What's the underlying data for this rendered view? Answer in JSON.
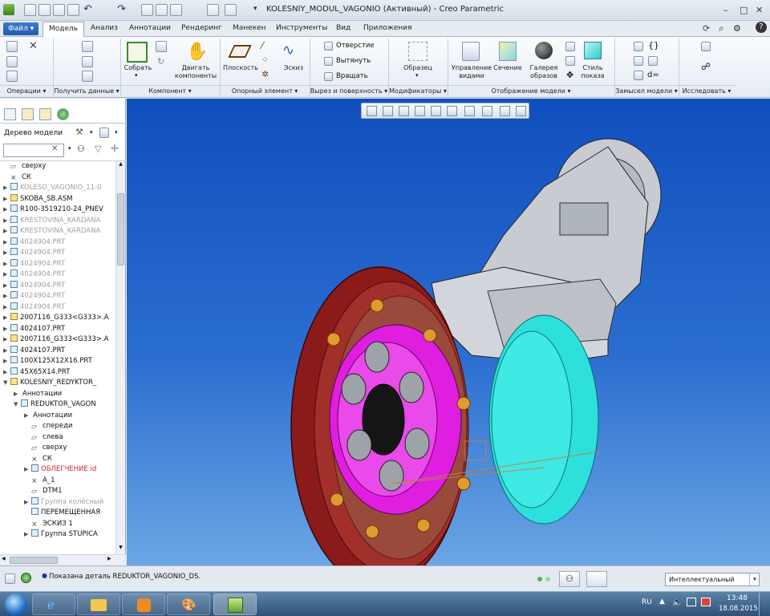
{
  "window": {
    "title": "KOLESNIY_MODUL_VAGONIO (Активный) - Creo Parametric",
    "controls": [
      "–",
      "□",
      "✕"
    ]
  },
  "menu": {
    "tabs": [
      "Файл",
      "Модель",
      "Анализ",
      "Аннотации",
      "Рендеринг",
      "Манекен",
      "Инструменты",
      "Вид",
      "Приложения"
    ],
    "active": "Модель"
  },
  "ribbon": {
    "buttons": {
      "assemble": "Собрать",
      "drag": "Двигать компоненты",
      "plane": "Плоскость",
      "sketch": "Эскиз",
      "hole": "Отверстие",
      "extrude": "Вытянуть",
      "revolve": "Вращать",
      "pattern": "Образец",
      "view_manager": "Управление видами",
      "section": "Сечение",
      "appearance": "Галерея образов",
      "display_style": "Стиль показа",
      "d_equals": "d="
    },
    "groups": [
      "Операции",
      "Получить данные",
      "Компонент",
      "Опорный элемент",
      "Вырез и поверхность",
      "Модификаторы",
      "Отображение модели",
      "Замысел модели",
      "Исследовать"
    ]
  },
  "panel": {
    "tree_title": "Дерево модели",
    "search_placeholder": "",
    "items": [
      {
        "label": "сверху",
        "icon": "plane",
        "indent": 0,
        "toggle": "",
        "style": ""
      },
      {
        "label": "СК",
        "icon": "csys",
        "indent": 0,
        "toggle": "",
        "style": ""
      },
      {
        "label": "KOLESO_VAGONIO_11-0",
        "icon": "part",
        "indent": 0,
        "toggle": "▶",
        "style": "dim"
      },
      {
        "label": "SKOBA_SB.ASM",
        "icon": "asm",
        "indent": 0,
        "toggle": "▶",
        "style": ""
      },
      {
        "label": "R100-3519210-24_PNEV",
        "icon": "part",
        "indent": 0,
        "toggle": "▶",
        "style": ""
      },
      {
        "label": "KRESTOVINA_KARDANA",
        "icon": "part",
        "indent": 0,
        "toggle": "▶",
        "style": "dim"
      },
      {
        "label": "KRESTOVINA_KARDANA",
        "icon": "part",
        "indent": 0,
        "toggle": "▶",
        "style": "dim"
      },
      {
        "label": "4024904.PRT",
        "icon": "part",
        "indent": 0,
        "toggle": "▶",
        "style": "dim"
      },
      {
        "label": "4024904.PRT",
        "icon": "part",
        "indent": 0,
        "toggle": "▶",
        "style": "dim"
      },
      {
        "label": "4024904.PRT",
        "icon": "part",
        "indent": 0,
        "toggle": "▶",
        "style": "dim"
      },
      {
        "label": "4024904.PRT",
        "icon": "part",
        "indent": 0,
        "toggle": "▶",
        "style": "dim"
      },
      {
        "label": "4024904.PRT",
        "icon": "part",
        "indent": 0,
        "toggle": "▶",
        "style": "dim"
      },
      {
        "label": "4024904.PRT",
        "icon": "part",
        "indent": 0,
        "toggle": "▶",
        "style": "dim"
      },
      {
        "label": "4024904.PRT",
        "icon": "part",
        "indent": 0,
        "toggle": "▶",
        "style": "dim"
      },
      {
        "label": "2007116_G333<G333>.A",
        "icon": "asm",
        "indent": 0,
        "toggle": "▶",
        "style": ""
      },
      {
        "label": "4024107.PRT",
        "icon": "part",
        "indent": 0,
        "toggle": "▶",
        "style": ""
      },
      {
        "label": "2007116_G333<G333>.A",
        "icon": "asm",
        "indent": 0,
        "toggle": "▶",
        "style": ""
      },
      {
        "label": "4024107.PRT",
        "icon": "part",
        "indent": 0,
        "toggle": "▶",
        "style": ""
      },
      {
        "label": "100X125X12X16.PRT",
        "icon": "part",
        "indent": 0,
        "toggle": "▶",
        "style": ""
      },
      {
        "label": "45X65X14.PRT",
        "icon": "part",
        "indent": 0,
        "toggle": "▶",
        "style": ""
      },
      {
        "label": "KOLESNIY_REDYKTOR_",
        "icon": "asm",
        "indent": 0,
        "toggle": "▼",
        "style": ""
      },
      {
        "label": "Аннотации",
        "icon": "none",
        "indent": 1,
        "toggle": "▶",
        "style": ""
      },
      {
        "label": "REDUKTOR_VAGON",
        "icon": "part",
        "indent": 1,
        "toggle": "▼",
        "style": ""
      },
      {
        "label": "Аннотации",
        "icon": "none",
        "indent": 2,
        "toggle": "▶",
        "style": ""
      },
      {
        "label": "спереди",
        "icon": "plane",
        "indent": 2,
        "toggle": "",
        "style": ""
      },
      {
        "label": "слева",
        "icon": "plane",
        "indent": 2,
        "toggle": "",
        "style": ""
      },
      {
        "label": "сверху",
        "icon": "plane",
        "indent": 2,
        "toggle": "",
        "style": ""
      },
      {
        "label": "СК",
        "icon": "csys",
        "indent": 2,
        "toggle": "",
        "style": ""
      },
      {
        "label": "ОБЛЕГЧЕНИЕ id",
        "icon": "part",
        "indent": 2,
        "toggle": "▶",
        "style": "red"
      },
      {
        "label": "A_1",
        "icon": "csys",
        "indent": 2,
        "toggle": "",
        "style": ""
      },
      {
        "label": "DTM1",
        "icon": "plane",
        "indent": 2,
        "toggle": "",
        "style": ""
      },
      {
        "label": "Группа колёсный",
        "icon": "part",
        "indent": 2,
        "toggle": "▶",
        "style": "dim"
      },
      {
        "label": "ПЕРЕМЕЩЕННАЯ",
        "icon": "part",
        "indent": 2,
        "toggle": "",
        "style": ""
      },
      {
        "label": "ЭСКИЗ 1",
        "icon": "csys",
        "indent": 2,
        "toggle": "",
        "style": ""
      },
      {
        "label": "Группа STUPICA",
        "icon": "part",
        "indent": 2,
        "toggle": "▶",
        "style": ""
      }
    ]
  },
  "status": {
    "message": "Показана деталь REDUKTOR_VAGONIO_DS.",
    "filter": "Интеллектуальный"
  },
  "taskbar": {
    "lang": "RU",
    "time": "13:48",
    "date": "18.08.2015"
  },
  "colors": {
    "wheel_hub": "#e01ee0",
    "disc": "#2ee0dc",
    "rim": "#8b1a1a",
    "housing": "#c8ccd2"
  }
}
